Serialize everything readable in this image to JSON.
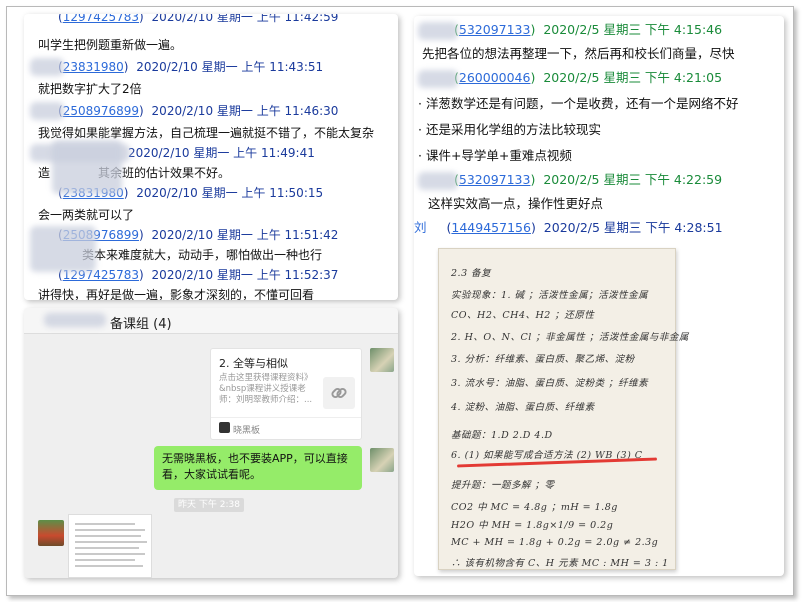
{
  "panelA": {
    "messages": [
      {
        "id_prefix": "",
        "qq": "1297425783",
        "time": "2020/2/10 星期一 上午 11:42:59",
        "text": "叫学生把例题重新做一遍。"
      },
      {
        "id_prefix": "",
        "qq": "23831980",
        "time": "2020/2/10 星期一 上午 11:43:51",
        "text": "就把数字扩大了2倍"
      },
      {
        "id_prefix": "",
        "qq": "2508976899",
        "time": "2020/2/10 星期一 上午 11:46:30",
        "text": "我觉得如果能掌握方法，自己梳理一遍就挺不错了，不能太复杂"
      },
      {
        "id_prefix": "",
        "qq": "",
        "time": "2020/2/10 星期一 上午 11:49:41",
        "text": "其余班的估计效果不好。"
      },
      {
        "id_prefix": "",
        "qq": "23831980",
        "time": "2020/2/10 星期一 上午 11:50:15",
        "text": "会一两类就可以了"
      },
      {
        "id_prefix": "",
        "qq": "2508976899",
        "time": "2020/2/10 星期一 上午 11:51:42",
        "text": "类本来难度就大，动动手，哪怕做出一种也行"
      },
      {
        "id_prefix": "",
        "qq": "1297425783",
        "time": "2020/2/10 星期一 上午 11:52:37",
        "text": "讲得快，再好是做一遍，影象才深刻的，不懂可回看"
      }
    ],
    "body_prefix_4": "造"
  },
  "panelB": {
    "messages": [
      {
        "qq": "532097133",
        "time": "2020/2/5 星期三 下午 4:15:46",
        "lines": [
          "先把各位的想法再整理一下，然后再和校长们商量，尽快"
        ],
        "green": true
      },
      {
        "qq": "260000046",
        "time": "2020/2/5 星期三 下午 4:21:05",
        "lines": [
          "洋葱数学还是有问题，一个是收费，还有一个是网络不好",
          "还是采用化学组的方法比较现实",
          "课件+导学单+重难点视频"
        ],
        "green": true
      },
      {
        "qq": "532097133",
        "time": "2020/2/5 星期三 下午 4:22:59",
        "lines": [
          "这样实效高一点，操作性更好点"
        ],
        "green": true
      },
      {
        "name": "刘",
        "qq": "1449457156",
        "time": "2020/2/5 星期三 下午 4:28:51",
        "lines": [],
        "green": false
      }
    ],
    "notebook": [
      "2.3 备复",
      "实验现象：1. 碱 ；活泼性金属；活泼性金属",
      "CO、H2、CH4、H2 ；还原性",
      "2. H、O、N、Cl ；非金属性 ；活泼性金属与非金属",
      "3. 分析：纤维素、蛋白质、聚乙烯、淀粉",
      "3. 流水号：油脂、蛋白质、淀粉类 ；纤维素",
      "4. 淀粉、油脂、蛋白质、纤维素",
      "基础题：1.D   2.D   4.D",
      "6. (1) 如果能写成合适方法 (2) WB  (3) C",
      "提升题：一题多解 ；零",
      "CO2 中 MC = 4.8g ；mH = 1.8g",
      "H2O 中 MH = 1.8g×1/9 = 0.2g",
      "MC + MH = 1.8g + 0.2g = 2.0g ≠ 2.3g",
      "∴ 该有机物含有 C、H 元素  MC : MH = 3 : 1"
    ]
  },
  "panelC": {
    "title": "备课组 (4)",
    "card": {
      "title": "2. 全等与相似",
      "desc": "点击这里获得课程资料》&nbsp课程讲义授课老师：刘明翠教师介绍：...",
      "source": "晓黑板"
    },
    "green_text": "无需晓黑板，也不要装APP，可以直接看，大家试试看呢。",
    "timestamp": "昨天 下午 2:38"
  }
}
